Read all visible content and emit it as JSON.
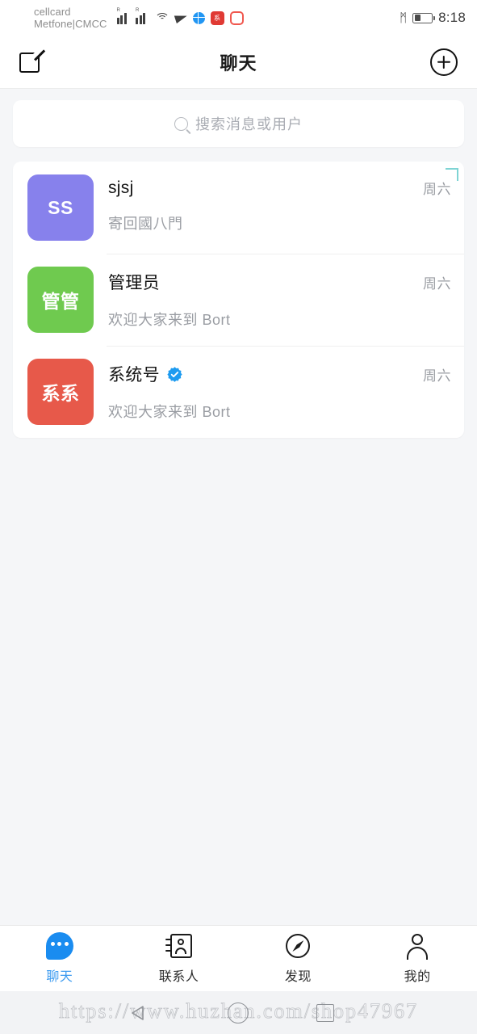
{
  "status_bar": {
    "carrier_line1": "cellcard",
    "carrier_line2": "Metfone|CMCC",
    "roaming_label": "R",
    "icons": [
      "signal-bars-sim1",
      "signal-bars-sim2",
      "wifi-icon",
      "telegram-icon",
      "globe-icon",
      "app-badge-icon",
      "app-square-icon",
      "bluetooth-icon",
      "battery-icon"
    ],
    "bluetooth_glyph": "ᛗ",
    "battery_percent": 36,
    "time": "8:18"
  },
  "header": {
    "title": "聊天",
    "compose_icon": "compose-icon",
    "add_icon": "plus-circle-icon"
  },
  "search": {
    "placeholder": "搜索消息或用户",
    "icon": "search-icon"
  },
  "chat_list": [
    {
      "avatar_text": "SS",
      "avatar_color": "#8781ec",
      "name": "sjsj",
      "verified": false,
      "message": "寄回國八門",
      "time": "周六"
    },
    {
      "avatar_text": "管管",
      "avatar_color": "#6fca4f",
      "name": "管理员",
      "verified": false,
      "message": "欢迎大家来到 Bort",
      "time": "周六"
    },
    {
      "avatar_text": "系系",
      "avatar_color": "#e7594a",
      "name": "系统号",
      "verified": true,
      "message": "欢迎大家来到 Bort",
      "time": "周六"
    }
  ],
  "corner_marker": {
    "name": "corner-bracket-marker",
    "color": "#7fd4d4"
  },
  "tab_bar": {
    "active_color": "#3d9bf0",
    "items": [
      {
        "label": "聊天",
        "icon": "chat-bubble-icon",
        "active": true
      },
      {
        "label": "联系人",
        "icon": "contacts-book-icon",
        "active": false
      },
      {
        "label": "发现",
        "icon": "compass-icon",
        "active": false
      },
      {
        "label": "我的",
        "icon": "person-icon",
        "active": false
      }
    ]
  },
  "system_nav": {
    "watermark": "https://www.huzhan.com/shop47967",
    "back_icon": "nav-back-icon",
    "home_icon": "nav-home-icon",
    "recents_icon": "nav-recents-icon"
  }
}
